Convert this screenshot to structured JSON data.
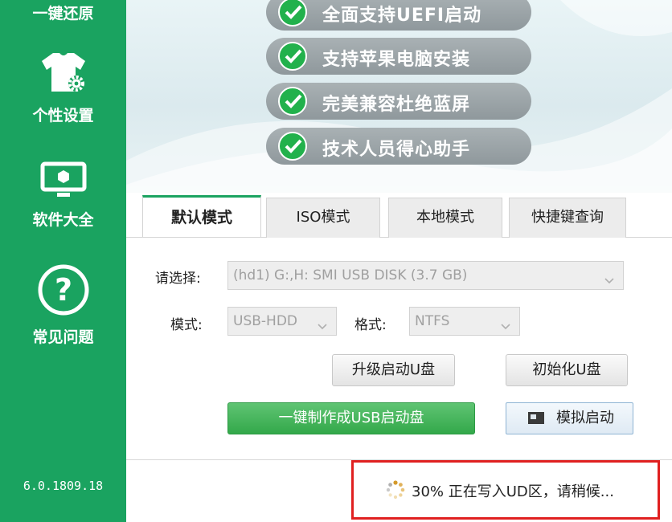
{
  "sidebar": {
    "items": [
      {
        "label": "一键还原",
        "icon": "restore-icon"
      },
      {
        "label": "个性设置",
        "icon": "tshirt-gear-icon"
      },
      {
        "label": "软件大全",
        "icon": "monitor-icon"
      },
      {
        "label": "常见问题",
        "icon": "question-icon"
      }
    ],
    "version": "6.0.1809.18"
  },
  "banner": {
    "features": [
      "全面支持UEFI启动",
      "支持苹果电脑安装",
      "完美兼容杜绝蓝屏",
      "技术人员得心助手"
    ]
  },
  "tabs": [
    {
      "label": "默认模式",
      "active": true
    },
    {
      "label": "ISO模式",
      "active": false
    },
    {
      "label": "本地模式",
      "active": false
    },
    {
      "label": "快捷键查询",
      "active": false
    }
  ],
  "form": {
    "select_label": "请选择:",
    "disk_value": "(hd1) G:,H: SMI USB DISK (3.7 GB)",
    "mode_label": "模式:",
    "mode_value": "USB-HDD",
    "format_label": "格式:",
    "format_value": "NTFS"
  },
  "buttons": {
    "upgrade": "升级启动U盘",
    "init": "初始化U盘",
    "make": "一键制作成USB启动盘",
    "simulate": "模拟启动"
  },
  "status": {
    "text": "30% 正在写入UD区，请稍候...",
    "progress_percent": 30
  },
  "colors": {
    "sidebar": "#1aa360",
    "primary_button": "#33a84a",
    "status_border": "#e02020"
  }
}
